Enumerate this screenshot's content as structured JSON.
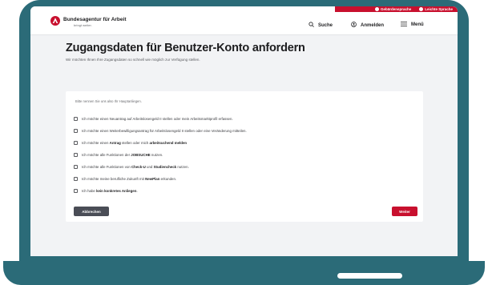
{
  "header": {
    "brand_name": "Bundesagentur für Arbeit",
    "tagline": "bringt weiter.",
    "top_links": [
      "Gebärdensprache",
      "Leichte Sprache"
    ],
    "search_label": "Suche",
    "login_label": "Anmelden",
    "menu_label": "Menü"
  },
  "main": {
    "title": "Zugangsdaten für Benutzer-Konto anfordern",
    "subtitle": "Wir möchten Ihnen Ihre Zugangsdaten so schnell wie möglich zur Verfügung stellen.",
    "card_hint": "Bitte nennen Sie uns also Ihr Hauptanliegen.",
    "options": [
      {
        "pre": "Ich möchte einen Neuantrag auf Arbeitslosengeld II stellen oder mein Arbeitsmarktprofil erfassen.",
        "bold": "",
        "post": ""
      },
      {
        "pre": "Ich möchte einen Weiterbewilligungsantrag für Arbeitslosengeld II stellen oder eine Veränderung mitteilen.",
        "bold": "",
        "post": ""
      },
      {
        "pre": "Ich möchte einen ",
        "bold": "Antrag",
        "post": " stellen oder mich ",
        "bold2": "arbeitsuchend melden"
      },
      {
        "pre": "Ich möchte alle Funktionen der ",
        "bold": "JOBSUCHE",
        "post": " nutzen."
      },
      {
        "pre": "Ich möchte alle Funktionen von ",
        "bold": "Check-U",
        "post": " und ",
        "bold2": "Studiencheck",
        "post2": " nutzen."
      },
      {
        "pre": "Ich möchte meine berufliche Zukunft mit ",
        "bold": "NewPlan",
        "post": " erkunden."
      },
      {
        "pre": "Ich habe ",
        "bold": "kein konkretes Anliegen",
        "post": "."
      }
    ],
    "cancel_label": "Abbrechen",
    "next_label": "Weiter"
  },
  "colors": {
    "device": "#2b6b78",
    "accent_red": "#c8102e",
    "cancel_button": "#4a4d56"
  }
}
